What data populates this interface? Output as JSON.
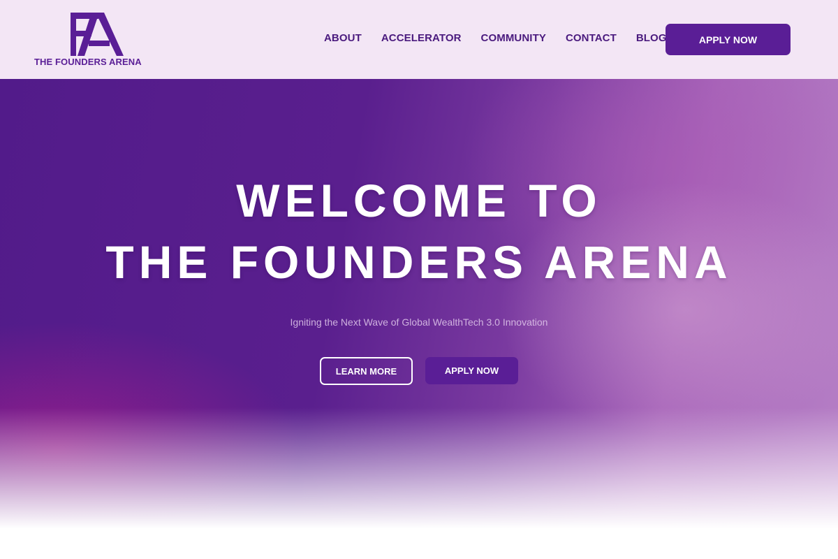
{
  "brand": {
    "name": "THE FOUNDERS ARENA",
    "logo_icon": "fa-monogram-logo",
    "color": "#5a1e96"
  },
  "nav": {
    "items": [
      {
        "label": "ABOUT"
      },
      {
        "label": "ACCELERATOR"
      },
      {
        "label": "COMMUNITY"
      },
      {
        "label": "CONTACT"
      },
      {
        "label": "BLOG"
      }
    ],
    "cta_label": "APPLY NOW"
  },
  "hero": {
    "title_line1": "WELCOME TO",
    "title_line2": "THE FOUNDERS ARENA",
    "subtitle": "Igniting the Next Wave of Global WealthTech 3.0 Innovation",
    "learn_more_label": "LEARN MORE",
    "apply_label": "APPLY NOW"
  },
  "colors": {
    "header_bg": "#f3e6f5",
    "accent": "#5a1e96",
    "hero_primary": "#521b8a",
    "hero_secondary": "#b680c6"
  }
}
